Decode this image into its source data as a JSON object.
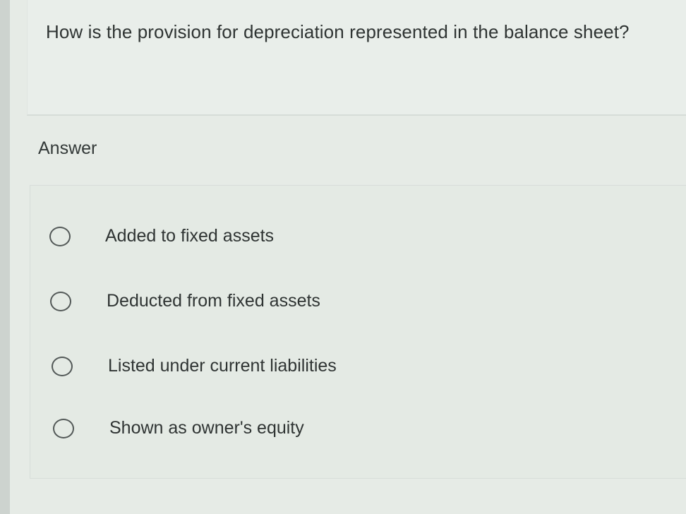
{
  "question": {
    "text": "How is the provision for depreciation represented in the balance sheet?"
  },
  "answer": {
    "heading": "Answer",
    "options": [
      {
        "label": "Added to fixed assets",
        "selected": false
      },
      {
        "label": "Deducted from fixed assets",
        "selected": false
      },
      {
        "label": "Listed under current liabilities",
        "selected": false
      },
      {
        "label": "Shown as owner's equity",
        "selected": false
      }
    ]
  }
}
